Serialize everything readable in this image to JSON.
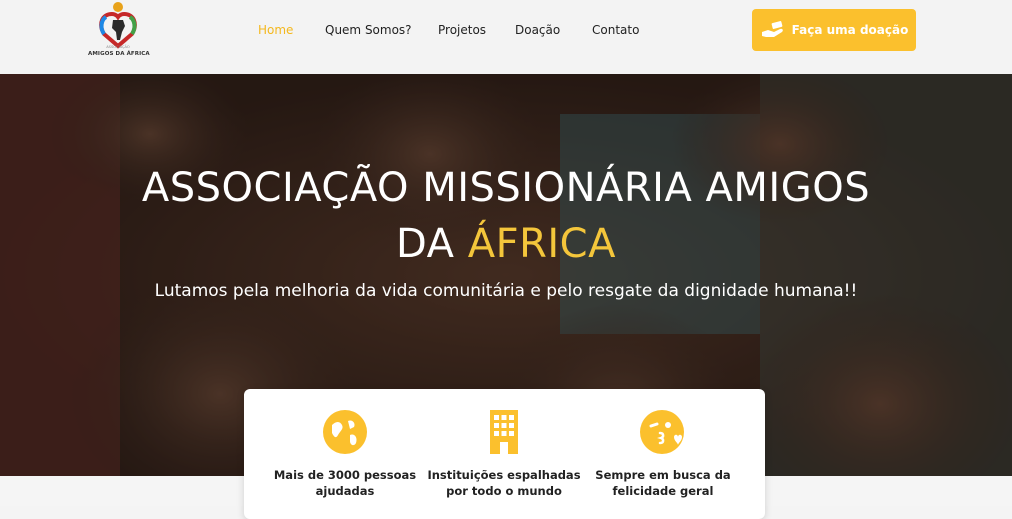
{
  "logo": {
    "title": "AMIGOS DA ÁFRICA",
    "subtitle": "ASSOCIAÇÃO"
  },
  "nav": [
    {
      "label": "Home",
      "active": true
    },
    {
      "label": "Quem Somos?"
    },
    {
      "label": "Projetos"
    },
    {
      "label": "Doação"
    },
    {
      "label": "Contato"
    }
  ],
  "donate_button": {
    "label": "Faça uma doação",
    "icon": "hand-money-icon"
  },
  "hero": {
    "title_line1": "ASSOCIAÇÃO MISSIONÁRIA AMIGOS",
    "title_line2_prefix": "DA ",
    "title_highlight": "ÁFRICA",
    "subtitle": "Lutamos pela melhoria da vida comunitária e pelo resgate da dignidade humana!!"
  },
  "features": [
    {
      "icon": "globe-icon",
      "text": "Mais de 3000 pessoas ajudadas"
    },
    {
      "icon": "building-icon",
      "text": "Instituições espalhadas por todo o mundo"
    },
    {
      "icon": "kiss-face-icon",
      "text": "Sempre em busca da felicidade geral"
    }
  ],
  "colors": {
    "accent": "#fbc02d",
    "highlight": "#f4c63b",
    "header_bg": "#f3f3f3"
  }
}
